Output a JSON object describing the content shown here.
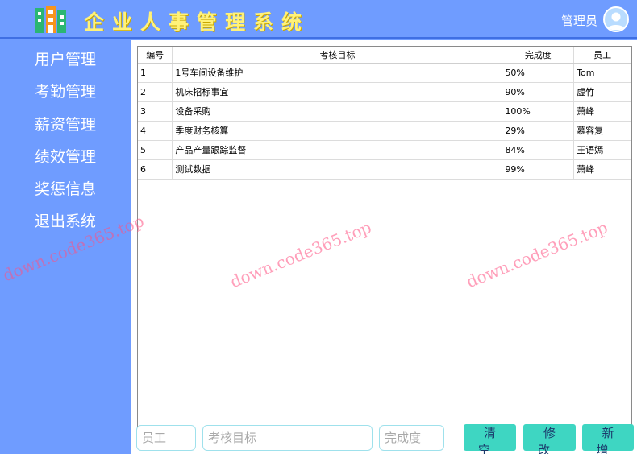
{
  "app": {
    "title": "企业人事管理系统"
  },
  "header": {
    "user_label": "管理员"
  },
  "sidebar": {
    "items": [
      {
        "label": "用户管理"
      },
      {
        "label": "考勤管理"
      },
      {
        "label": "薪资管理"
      },
      {
        "label": "绩效管理"
      },
      {
        "label": "奖惩信息"
      },
      {
        "label": "退出系统"
      }
    ]
  },
  "table": {
    "headers": [
      "编号",
      "考核目标",
      "完成度",
      "员工"
    ],
    "rows": [
      [
        "1",
        "1号车间设备维护",
        "50%",
        "Tom"
      ],
      [
        "2",
        "机床招标事宜",
        "90%",
        "虚竹"
      ],
      [
        "3",
        "设备采购",
        "100%",
        "萧峰"
      ],
      [
        "4",
        "季度财务核算",
        "29%",
        "慕容复"
      ],
      [
        "5",
        "产品产量跟踪监督",
        "84%",
        "王语嫣"
      ],
      [
        "6",
        "测试数据",
        "99%",
        "萧峰"
      ]
    ]
  },
  "form": {
    "employee_placeholder": "员工",
    "goal_placeholder": "考核目标",
    "completion_placeholder": "完成度",
    "clear_label": "清空",
    "edit_label": "修改",
    "add_label": "新增"
  },
  "watermark": {
    "text": "down.code365.top"
  },
  "colors": {
    "background": "#6f9cff",
    "title": "#fff27a",
    "button": "#3ed6c2",
    "input_border": "#9fe1ec"
  }
}
